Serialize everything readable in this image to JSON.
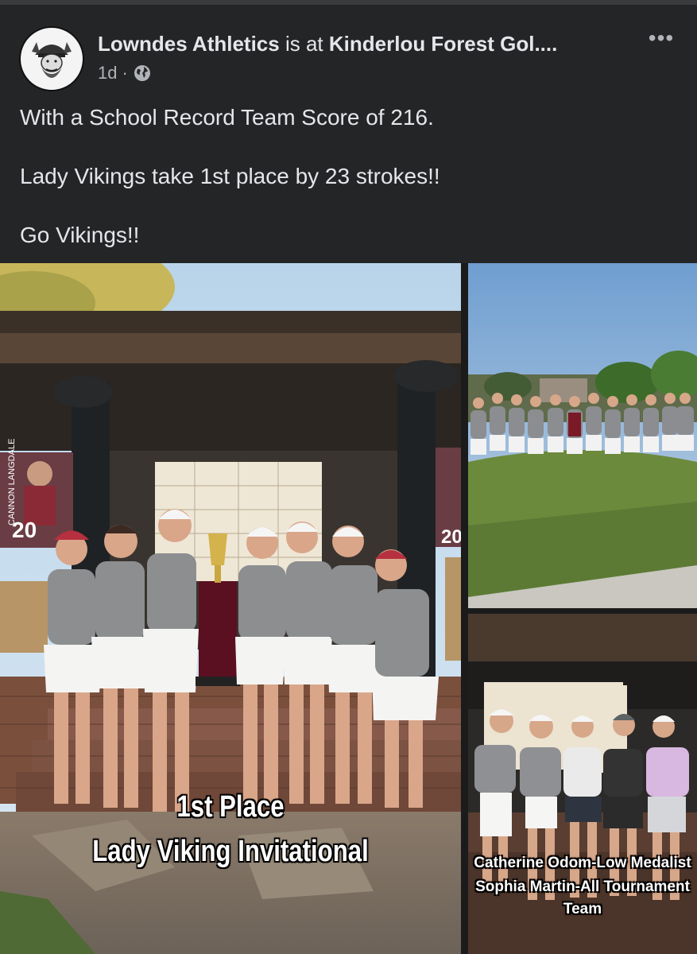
{
  "post": {
    "author": "Lowndes Athletics",
    "connector": " is at ",
    "location": "Kinderlou Forest Gol....",
    "time": "1d",
    "separator": "·",
    "privacy_icon": "globe-icon",
    "more_icon": "more-options-icon",
    "more_label": "•••",
    "text_lines": [
      "With a School Record Team Score of 216.",
      "Lady Vikings take 1st place by 23 strokes!!",
      "Go Vikings!!"
    ]
  },
  "photos": {
    "main": {
      "caption_line1": "1st Place",
      "caption_line2": "Lady Viking Invitational",
      "banner_name": "CANNON LANGDALE",
      "banner_year": "20"
    },
    "bottom_right": {
      "caption_line1": "Catherine Odom-Low Medalist",
      "caption_line2": "Sophia Martin-All Tournament",
      "caption_line3": "Team"
    }
  },
  "colors": {
    "background": "#242526",
    "text_primary": "#e4e6eb",
    "text_secondary": "#b0b3b8"
  }
}
